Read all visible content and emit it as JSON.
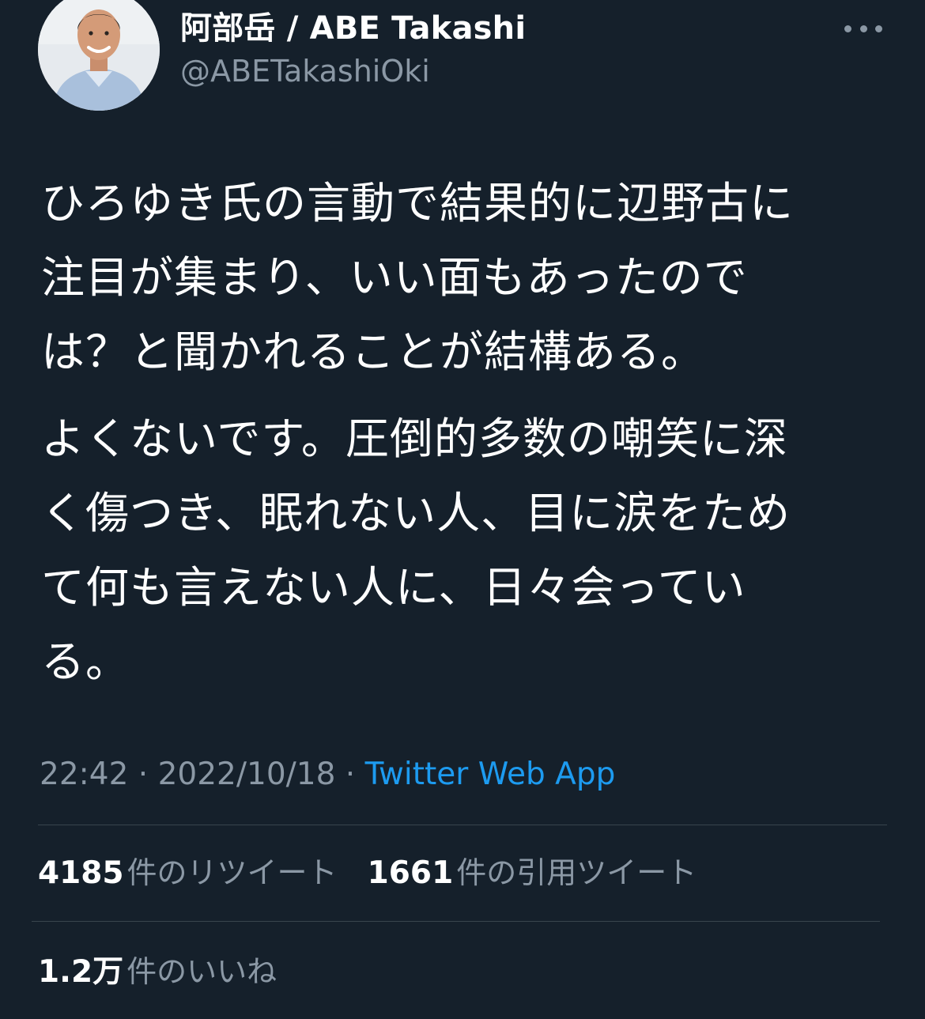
{
  "user": {
    "display_name": "阿部岳 / ABE Takashi",
    "handle": "@ABETakashiOki",
    "avatar_icon": "profile-photo"
  },
  "header": {
    "more_icon": "more-options-icon"
  },
  "tweet": {
    "paragraphs": [
      "ひろゆき氏の言動で結果的に辺野古に\n注目が集まり、いい面もあったので\nは？と聞かれることが結構ある。",
      "よくないです。圧倒的多数の嘲笑に深\nく傷つき、眠れない人、目に涙をため\nて何も言えない人に、日々会ってい\nる。"
    ]
  },
  "meta": {
    "time": "22:42",
    "separator": " · ",
    "date": "2022/10/18",
    "source": "Twitter Web App"
  },
  "stats": {
    "retweets": {
      "count": "4185",
      "label": "件のリツイート"
    },
    "quotes": {
      "count": "1661",
      "label": "件の引用ツイート"
    },
    "likes": {
      "count": "1.2万",
      "label": "件のいいね"
    }
  },
  "colors": {
    "background": "#15202b",
    "text_primary": "#ffffff",
    "text_secondary": "#8b98a5",
    "link": "#1d9bf0",
    "divider": "#38444d"
  }
}
